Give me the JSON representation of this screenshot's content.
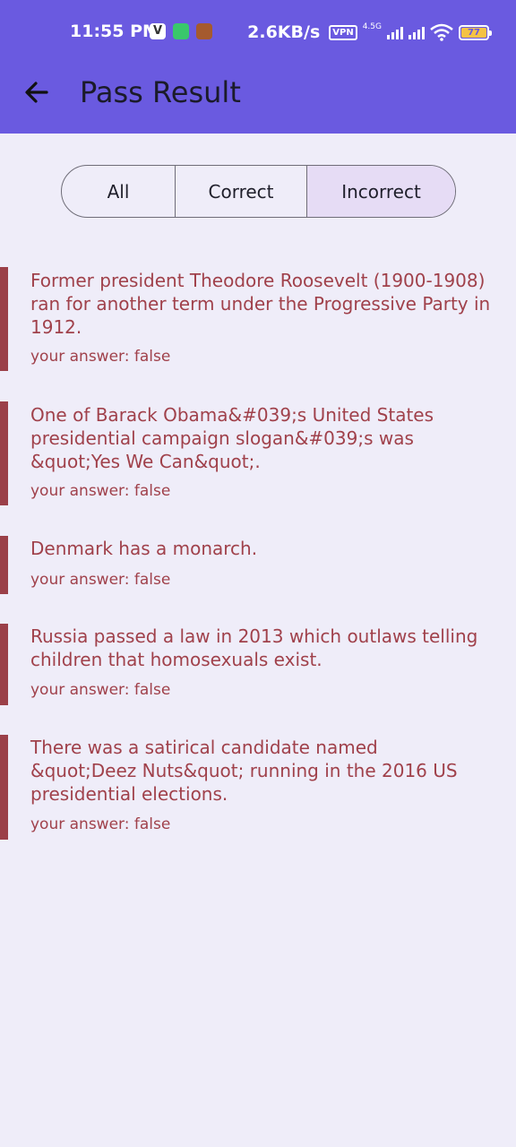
{
  "status_bar": {
    "time": "11:55 PM",
    "app_icons": [
      "v-app-icon",
      "alarm-app-icon",
      "game-app-icon"
    ],
    "net_speed": "2.6KB/s",
    "vpn": "VPN",
    "network_type": "4.5G",
    "battery_level": "77"
  },
  "app_bar": {
    "back_icon": "arrow-left-icon",
    "title": "Pass Result"
  },
  "filter": {
    "options": [
      {
        "label": "All"
      },
      {
        "label": "Correct"
      },
      {
        "label": "Incorrect"
      }
    ],
    "selected": "Incorrect"
  },
  "results": [
    {
      "question": "Former president Theodore Roosevelt (1900-1908) ran for another term under the Progressive Party in 1912.",
      "answer": "your answer: false"
    },
    {
      "question": "One of Barack Obama&#039;s United States presidential campaign slogan&#039;s was &quot;Yes We Can&quot;.",
      "answer": "your answer: false"
    },
    {
      "question": "Denmark has a monarch.",
      "answer": "your answer: false"
    },
    {
      "question": "Russia passed a law in 2013 which outlaws telling children that homosexuals exist.",
      "answer": "your answer: false"
    },
    {
      "question": "There was a satirical candidate named &quot;Deez Nuts&quot; running in the 2016 US presidential elections.",
      "answer": "your answer: false"
    }
  ],
  "colors": {
    "app_bar": "#6a5ae0",
    "background": "#efedf9",
    "incorrect": "#a0414b",
    "selected_segment": "#e6dcf5"
  }
}
